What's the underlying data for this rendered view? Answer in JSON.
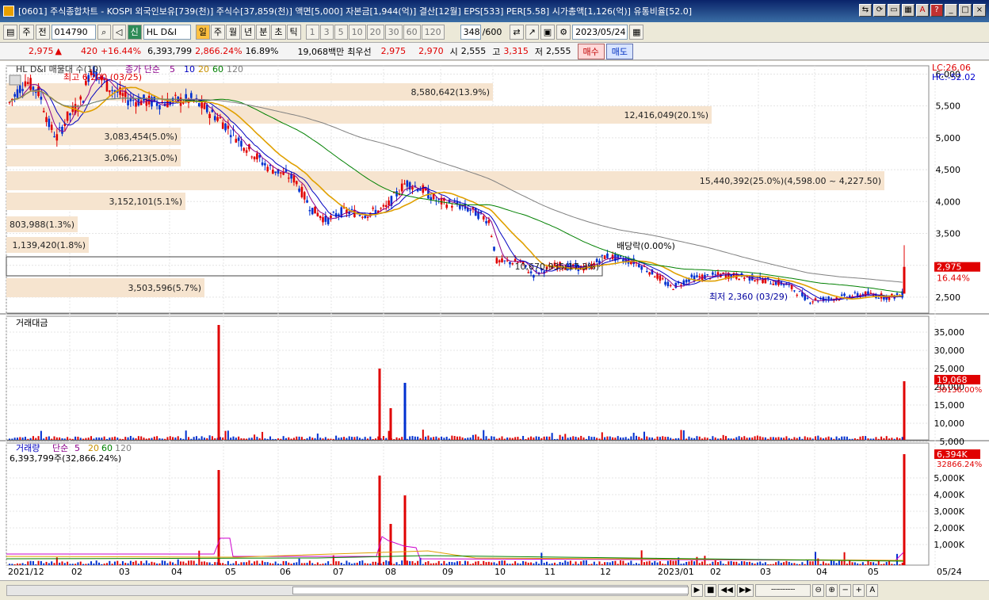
{
  "window": {
    "title": "[0601] 주식종합차트 - KOSPI 외국인보유[739(천)] 주식수[37,859(천)] 액면[5,000] 자본금[1,944(억)] 결산[12월] EPS[533] PER[5.58] 시가총액[1,126(억)] 유통비율[52.0]"
  },
  "toolbar": {
    "market_label": "주",
    "prev_label": "전",
    "code": "014790",
    "search_icon": "search-icon",
    "credit_label": "신",
    "stock_name": "HL D&I",
    "periods": [
      "일",
      "주",
      "월",
      "년",
      "분",
      "초",
      "틱"
    ],
    "selected_period": "일",
    "intervals": [
      "1",
      "3",
      "5",
      "10",
      "20",
      "30",
      "60",
      "120"
    ],
    "count": "348",
    "count_total": "/600",
    "date": "2023/05/24"
  },
  "quote": {
    "price": "2,975",
    "arrow": "▲",
    "change": "420",
    "change_pct": "+16.44%",
    "volume": "6,393,799",
    "volume_ratio": "2,866.24%",
    "turnover": "16.89%",
    "amount": "19,068백만",
    "best_ask_label": "최우선",
    "best_ask": "2,975",
    "best_bid": "2,970",
    "open_label": "시",
    "open": "2,555",
    "high_label": "고",
    "high": "3,315",
    "low_label": "저",
    "low": "2,555",
    "buy_label": "매수",
    "sell_label": "매도"
  },
  "chart_data": {
    "type": "candlestick",
    "title": "HL D&I 매물대 수(10)",
    "ma_label": "종가 단순",
    "ma_periods": [
      "5",
      "10",
      "20",
      "60",
      "120"
    ],
    "lc_label": "LC:26.06",
    "hc_label": "HC:-52.02",
    "y_ticks": [
      6000,
      5500,
      5000,
      4500,
      4000,
      3500,
      3000,
      2500
    ],
    "x_ticks": [
      "2021/12",
      "02",
      "03",
      "04",
      "05",
      "06",
      "07",
      "08",
      "09",
      "10",
      "11",
      "12",
      "2023/01",
      "02",
      "03",
      "04",
      "05",
      "05/24"
    ],
    "last_price_label": "2,975",
    "last_change_label": "16.44%",
    "high_annotation": "최고 6,200 (03/25)",
    "low_annotation": "최저 2,360 (03/29)",
    "dividend_annotation": "배당락(0.00%)",
    "volume_profile": [
      {
        "label": "8,580,642(13.9%)"
      },
      {
        "label": "12,416,049(20.1%)"
      },
      {
        "label": "3,083,454(5.0%)"
      },
      {
        "label": "3,066,213(5.0%)"
      },
      {
        "label": "15,440,392(25.0%)(4,598.00 ~ 4,227.50)"
      },
      {
        "label": "3,152,101(5.1%)"
      },
      {
        "label": "803,988(1.3%)"
      },
      {
        "label": "1,139,420(1.8%)"
      },
      {
        "label": "10,670,935(17.3%)"
      },
      {
        "label": "3,503,596(5.7%)"
      }
    ],
    "amount_panel": {
      "title": "거래대금",
      "y_ticks": [
        "35,000",
        "30,000",
        "25,000",
        "20,000",
        "15,000",
        "10,000",
        "5,000"
      ],
      "last_label": "19,068",
      "sub_label": "38136.00%"
    },
    "volume_panel": {
      "title": "거래량",
      "ma_label": "단순",
      "ma_periods": [
        "5",
        "20",
        "60",
        "120"
      ],
      "info": "6,393,799주(32,866.24%)",
      "y_ticks": [
        "5,000K",
        "4,000K",
        "3,000K",
        "2,000K",
        "1,000K"
      ],
      "last_label": "6,394K",
      "sub_label": "32866.24%"
    }
  }
}
